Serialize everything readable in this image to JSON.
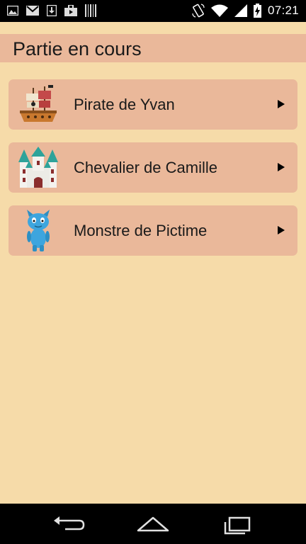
{
  "status_bar": {
    "time": "07:21",
    "left_icons": [
      "image-icon",
      "gmail-icon",
      "download-icon",
      "shop-icon",
      "barcode-icon"
    ],
    "right_icons": [
      "rotate-icon",
      "wifi-icon",
      "cellular-signal-icon",
      "battery-charging-icon"
    ]
  },
  "header": {
    "title": "Partie en cours"
  },
  "games": [
    {
      "label": "Pirate de Yvan",
      "icon": "pirate-ship-icon"
    },
    {
      "label": "Chevalier de Camille",
      "icon": "castle-icon"
    },
    {
      "label": "Monstre de Pictime",
      "icon": "monster-icon"
    }
  ],
  "nav_bar": {
    "buttons": [
      "back-icon",
      "home-icon",
      "recents-icon"
    ]
  },
  "colors": {
    "background": "#f6dba9",
    "item_background": "#eab89a",
    "header_background": "#eab89a"
  }
}
